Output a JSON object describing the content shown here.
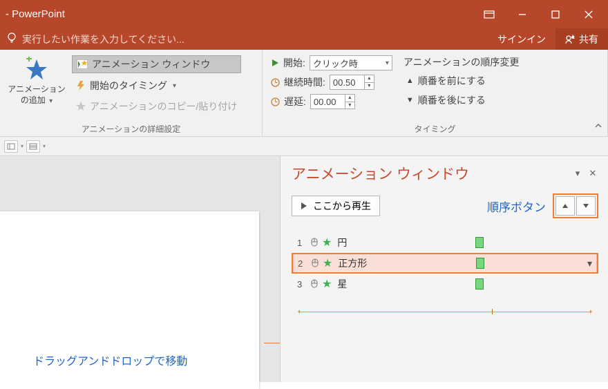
{
  "titlebar": {
    "app": "- PowerPoint"
  },
  "tellme": {
    "hint": "実行したい作業を入力してください...",
    "signin": "サインイン",
    "share": "共有"
  },
  "ribbon": {
    "add_anim": {
      "line1": "アニメーション",
      "line2": "の追加"
    },
    "anim_pane_btn": "アニメーション ウィンドウ",
    "trigger_btn": "開始のタイミング",
    "painter_btn": "アニメーションのコピー/貼り付け",
    "group1_label": "アニメーションの詳細設定",
    "start_label": "開始:",
    "start_value": "クリック時",
    "duration_label": "継続時間:",
    "duration_value": "00.50",
    "delay_label": "遅延:",
    "delay_value": "00.00",
    "reorder_title": "アニメーションの順序変更",
    "move_earlier": "順番を前にする",
    "move_later": "順番を後にする",
    "group2_label": "タイミング"
  },
  "annotation": {
    "drag": "ドラッグアンドドロップで移動",
    "order_label": "順序ボタン"
  },
  "animpane": {
    "title": "アニメーション ウィンドウ",
    "play": "ここから再生",
    "items": [
      {
        "num": "1",
        "name": "円"
      },
      {
        "num": "2",
        "name": "正方形"
      },
      {
        "num": "3",
        "name": "星"
      }
    ]
  }
}
